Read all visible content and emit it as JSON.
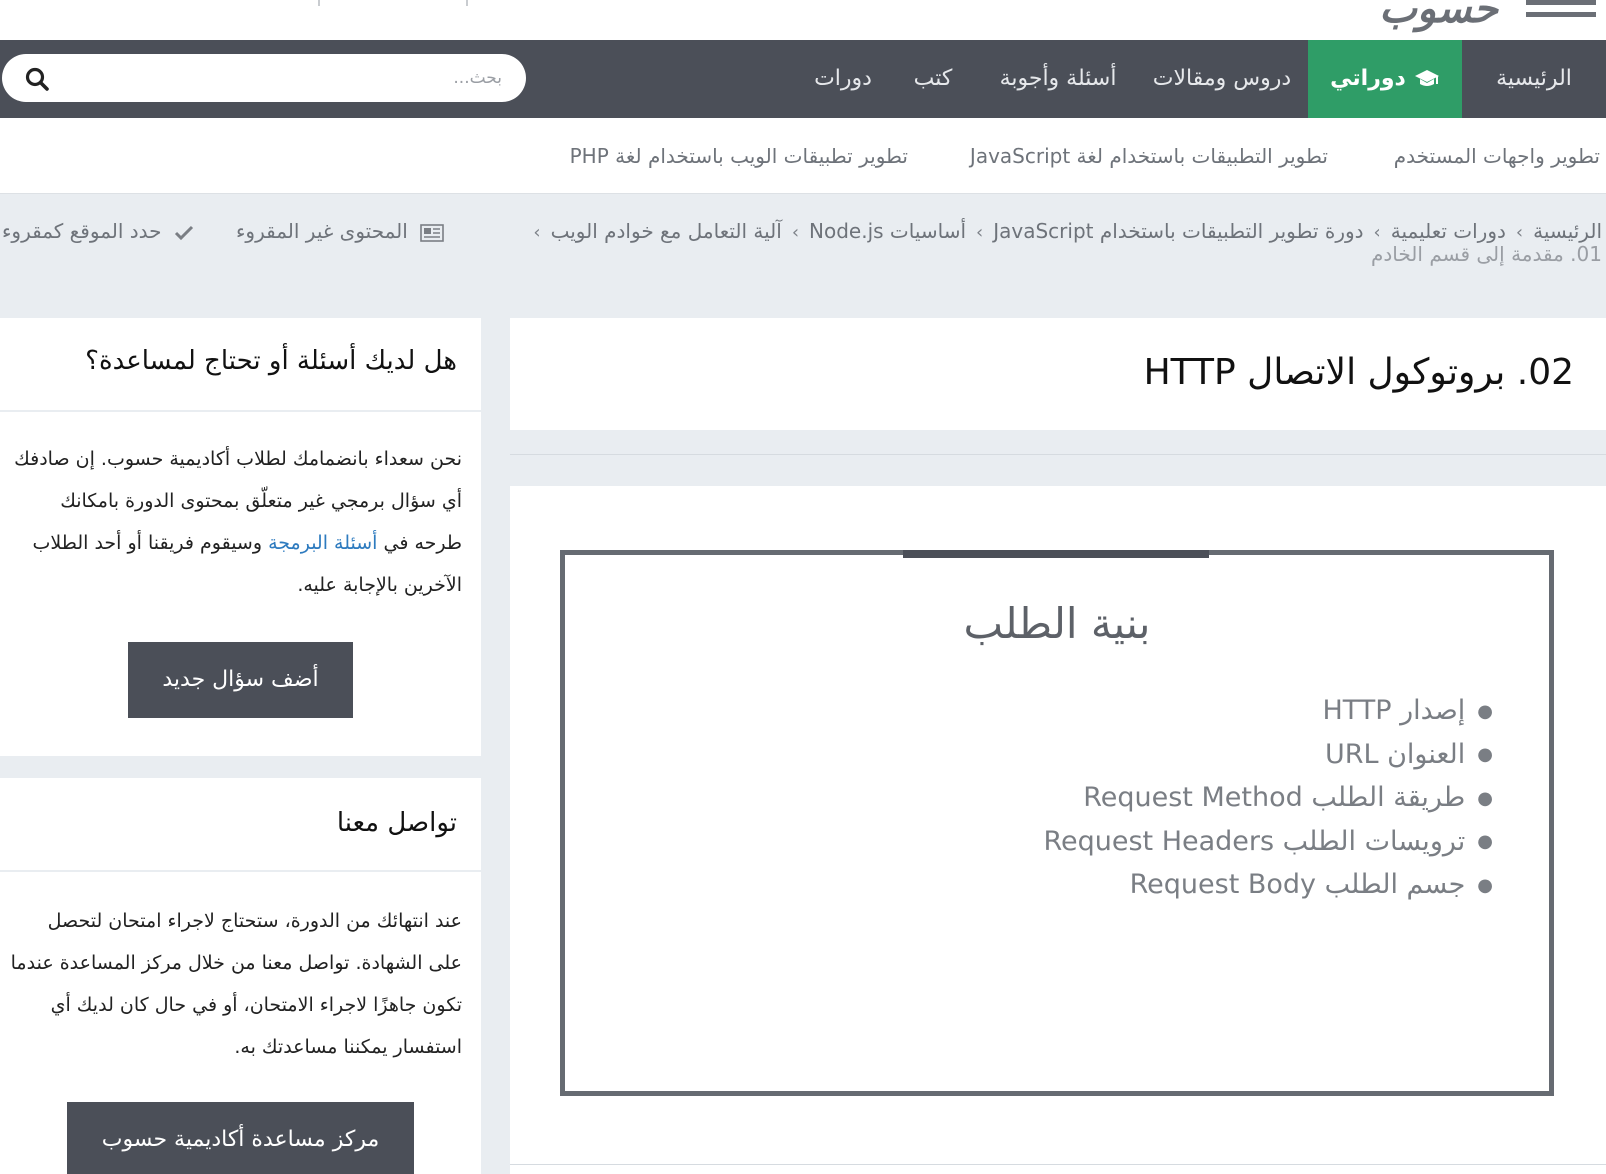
{
  "header": {
    "logo_text": "حسوب"
  },
  "nav": {
    "items": [
      {
        "label": "الرئيسية"
      },
      {
        "label": "دوراتي"
      },
      {
        "label": "دروس ومقالات"
      },
      {
        "label": "أسئلة وأجوبة"
      },
      {
        "label": "كتب"
      },
      {
        "label": "دورات"
      }
    ],
    "active_index": 1,
    "active_color": "#2f9d67",
    "search_placeholder": "بحث..."
  },
  "subnav": {
    "items": [
      {
        "label": "تطوير واجهات المستخدم"
      },
      {
        "label": "تطوير التطبيقات باستخدام لغة JavaScript"
      },
      {
        "label": "تطوير تطبيقات الويب باستخدام لغة PHP"
      }
    ]
  },
  "breadcrumb": {
    "items": [
      {
        "label": "الرئيسية"
      },
      {
        "label": "دورات تعليمية"
      },
      {
        "label": "دورة تطوير التطبيقات باستخدام JavaScript"
      },
      {
        "label": "أساسيات Node.js"
      },
      {
        "label": "آلية التعامل مع خوادم الويب"
      }
    ],
    "current": "01. مقدمة إلى قسم الخادم",
    "separator": "›"
  },
  "tools": {
    "unread_content": "المحتوى غير المقروء",
    "mark_read": "حدد الموقع كمقروء"
  },
  "lesson": {
    "title": "02. بروتوكول الاتصال HTTP",
    "slide": {
      "title": "بنية الطلب",
      "items": [
        "إصدار HTTP",
        "العنوان URL",
        "طريقة الطلب Request Method",
        "ترويسات الطلب Request Headers",
        "جسم الطلب Request Body"
      ]
    }
  },
  "sidebar": {
    "help": {
      "heading": "هل لديك أسئلة أو تحتاج لمساعدة؟",
      "text_before": "نحن سعداء بانضمامك لطلاب أكاديمية حسوب. إن صادفك أي سؤال برمجي غير متعلّق بمحتوى الدورة بامكانك طرحه في ",
      "link": "أسئلة البرمجة",
      "text_after": " وسيقوم فريقنا أو أحد الطلاب الآخرين بالإجابة عليه.",
      "button": "أضف سؤال جديد"
    },
    "contact": {
      "heading": "تواصل معنا",
      "text": "عند انتهائك من الدورة، ستحتاج لاجراء امتحان لتحصل على الشهادة. تواصل معنا من خلال مركز المساعدة عندما تكون جاهزًا لاجراء الامتحان، أو في حال كان لديك أي استفسار يمكننا مساعدتك به.",
      "button": "مركز مساعدة أكاديمية حسوب"
    }
  }
}
